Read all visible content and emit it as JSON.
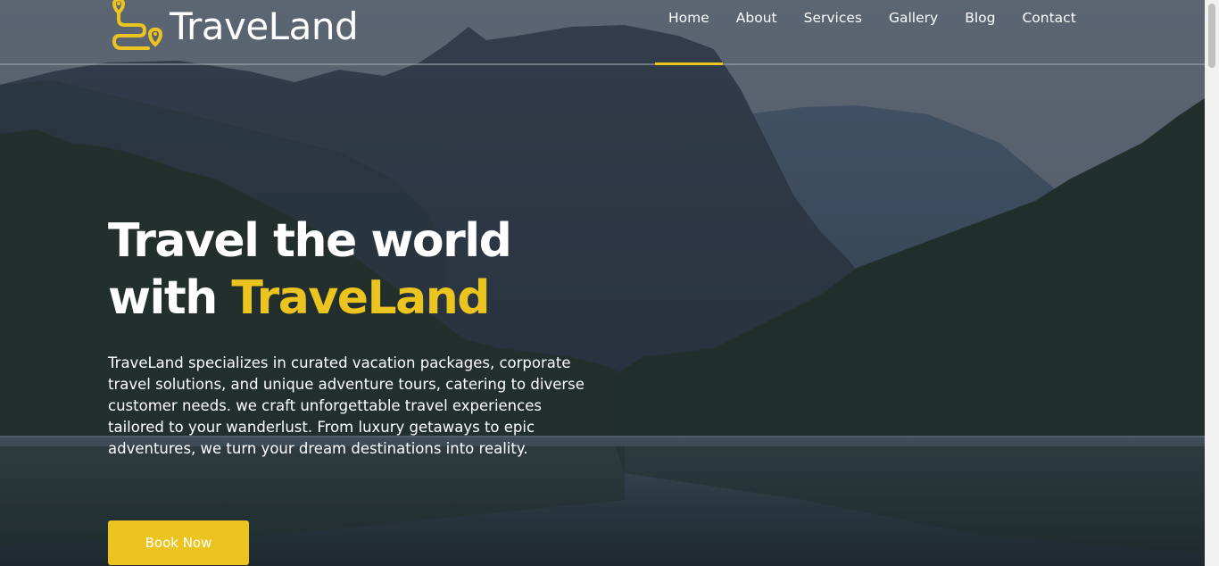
{
  "brand": {
    "name": "TraveLand",
    "accent_color": "#ecc420"
  },
  "nav": {
    "items": [
      {
        "label": "Home",
        "active": true
      },
      {
        "label": "About",
        "active": false
      },
      {
        "label": "Services",
        "active": false
      },
      {
        "label": "Gallery",
        "active": false
      },
      {
        "label": "Blog",
        "active": false
      },
      {
        "label": "Contact",
        "active": false
      }
    ]
  },
  "hero": {
    "headline_line1": "Travel the world",
    "headline_prefix": "with ",
    "headline_accent": "TraveLand",
    "description": "TraveLand specializes in curated vacation packages, corporate travel solutions, and unique adventure tours, catering to diverse customer needs. we craft unforgettable travel experiences tailored to your wanderlust. From luxury getaways to epic adventures, we turn your dream destinations into reality.",
    "cta_label": "Book Now",
    "background": "mountain-lake-forest-photo"
  }
}
